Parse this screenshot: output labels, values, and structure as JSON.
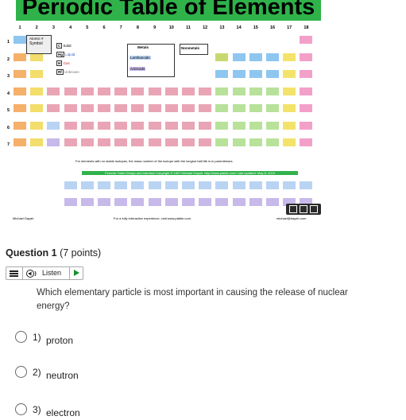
{
  "periodic_table": {
    "title": "Periodic Table of Elements",
    "groups": [
      "1",
      "2",
      "3",
      "4",
      "5",
      "6",
      "7",
      "8",
      "9",
      "10",
      "11",
      "12",
      "13",
      "14",
      "15",
      "16",
      "17",
      "18"
    ],
    "periods": [
      "1",
      "2",
      "3",
      "4",
      "5",
      "6",
      "7"
    ],
    "legend": {
      "solid": "Solid",
      "liquid": "Liquid",
      "gas": "Gas",
      "unknown": "Unknown",
      "metals": "Metals",
      "nonmetals": "Nonmetals",
      "lanthanoids": "Lanthanoids",
      "actinoids": "Actinoids",
      "key_label": "Atomic #",
      "key_symbol": "Symbol",
      "key_c": "C",
      "key_hg": "Hg",
      "key_h": "H",
      "key_rf": "Rf"
    },
    "note": "For elements with no stable isotopes, the mass number of the isotope with the longest half-life is in parentheses.",
    "copyright": "Periodic Table Design and Interface Copyright © 1997 Michael Dayah. http://www.ptable.com/ Last updated: May 8, 2019",
    "author": "Michael Dayah",
    "interactive_note": "For a fully interactive experience, visit www.ptable.com.",
    "email": "michael@dayah.com"
  },
  "question": {
    "label": "Question 1",
    "points": "(7 points)",
    "text": "Which elementary particle is most important in causing the release of nuclear energy?",
    "options": [
      {
        "number": "1)",
        "text": "proton"
      },
      {
        "number": "2)",
        "text": "neutron"
      },
      {
        "number": "3)",
        "text": "electron"
      }
    ]
  },
  "tts": {
    "listen_label": "Listen"
  },
  "colors": {
    "title_bg": "#2fb24a",
    "alkali": "#f5b06a",
    "alkaline": "#f3dd6b",
    "transition": "#e9a5b5",
    "post_transition": "#b8e19a",
    "metalloid": "#c9d86e",
    "nonmetal": "#8ec6f0",
    "halogen": "#f4e36b",
    "noble": "#f3a0c9",
    "lanthanoid": "#b9d3f2",
    "actinoid": "#c7b9ea",
    "accent": "#1a8f2e"
  }
}
